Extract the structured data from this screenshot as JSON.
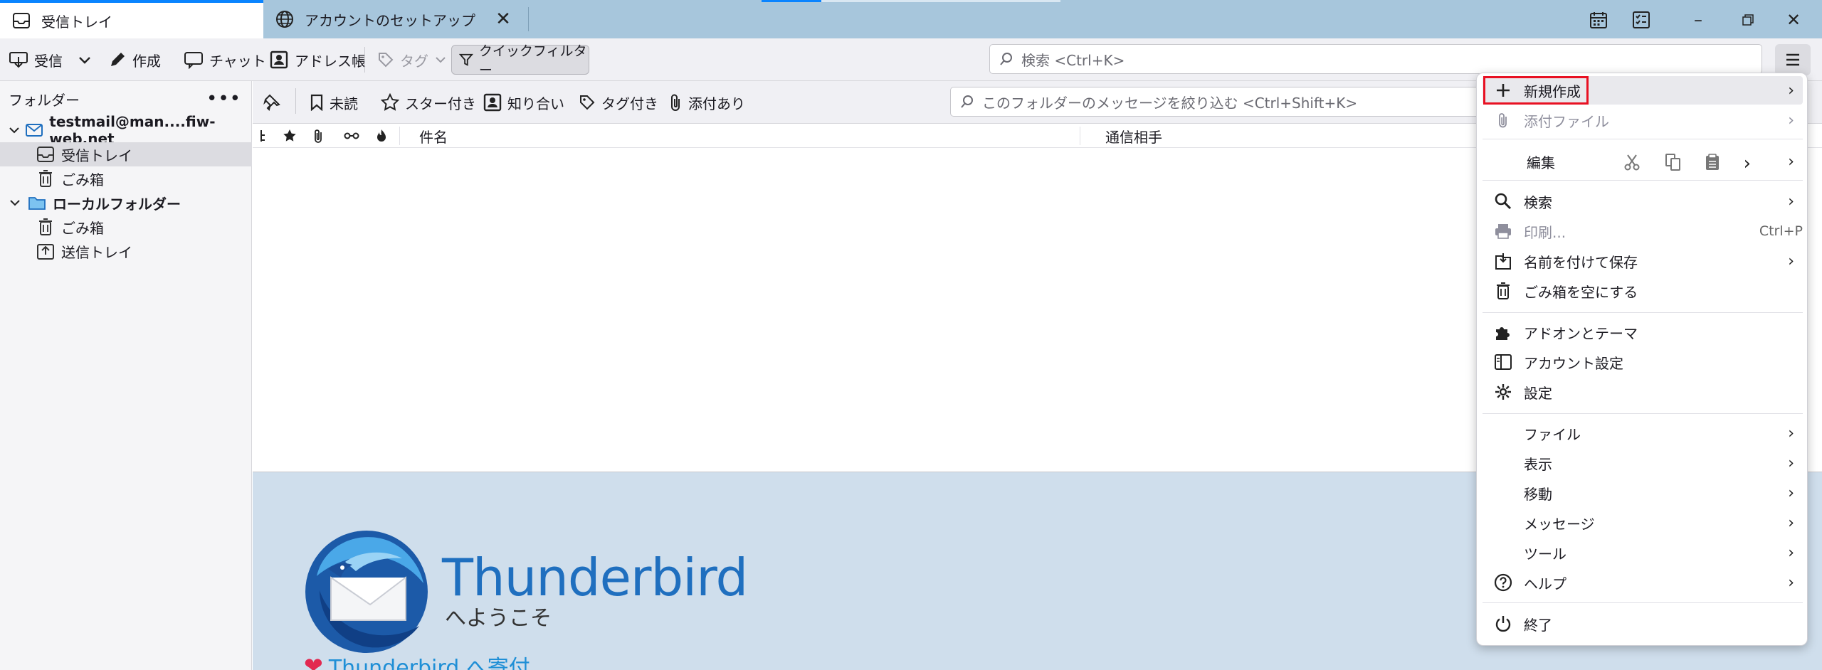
{
  "tabs": [
    {
      "label": "受信トレイ",
      "active": true
    },
    {
      "label": "アカウントのセットアップ",
      "active": false
    }
  ],
  "toolbar": {
    "get_messages": "受信",
    "write": "作成",
    "chat": "チャット",
    "address_book": "アドレス帳",
    "tag": "タグ",
    "quick_filter": "クイックフィルター",
    "search_placeholder": "検索 <Ctrl+K>"
  },
  "folder_pane": {
    "header": "フォルダー",
    "folders": [
      {
        "label": "testmail@man....fiw-web.net",
        "type": "account"
      },
      {
        "label": "受信トレイ",
        "type": "inbox",
        "selected": true
      },
      {
        "label": "ごみ箱",
        "type": "trash"
      },
      {
        "label": "ローカルフォルダー",
        "type": "local"
      },
      {
        "label": "ごみ箱",
        "type": "trash"
      },
      {
        "label": "送信トレイ",
        "type": "outbox"
      }
    ]
  },
  "quick_filter_bar": {
    "unread": "未読",
    "starred": "スター付き",
    "contacts": "知り合い",
    "tagged": "タグ付き",
    "attachment": "添付あり",
    "filter_placeholder": "このフォルダーのメッセージを絞り込む <Ctrl+Shift+K>"
  },
  "thread_columns": {
    "subject": "件名",
    "correspondent": "通信相手"
  },
  "welcome": {
    "brand": "Thunderbird",
    "subtitle": "へようこそ",
    "donate": "Thunderbird へ寄付"
  },
  "app_menu": {
    "new": "新規作成",
    "attachments": "添付ファイル",
    "edit": "編集",
    "find": "検索",
    "print": "印刷...",
    "print_shortcut": "Ctrl+P",
    "save_as": "名前を付けて保存",
    "empty_trash": "ごみ箱を空にする",
    "addons": "アドオンとテーマ",
    "account_settings": "アカウント設定",
    "settings": "設定",
    "file": "ファイル",
    "view": "表示",
    "go": "移動",
    "message": "メッセージ",
    "tools": "ツール",
    "help": "ヘルプ",
    "quit": "終了"
  },
  "colors": {
    "accent": "#0a84ff",
    "titlebar": "#a7c6dc",
    "highlight": "#e81123",
    "brand": "#1f6fbf"
  }
}
